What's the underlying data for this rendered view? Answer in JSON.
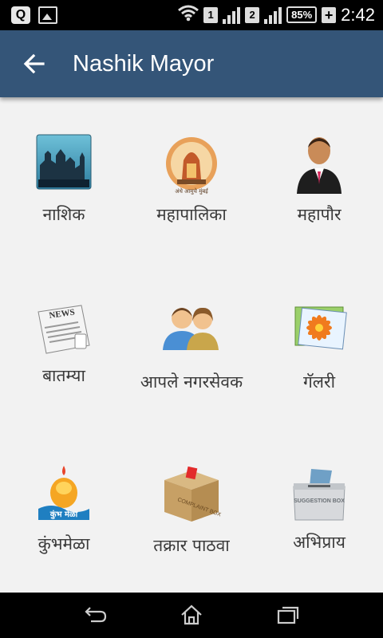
{
  "status_bar": {
    "q_icon_text": "Q",
    "sim1": "1",
    "sim2": "2",
    "battery": "85%",
    "time": "2:42"
  },
  "app_bar": {
    "title": "Nashik Mayor"
  },
  "tiles": [
    {
      "label": "नाशिक",
      "icon": "nashik-city-icon"
    },
    {
      "label": "महापालिका",
      "icon": "corporation-emblem-icon"
    },
    {
      "label": "महापौर",
      "icon": "mayor-person-icon"
    },
    {
      "label": "बातम्या",
      "icon": "newspaper-icon"
    },
    {
      "label": "आपले नगरसेवक",
      "icon": "corporators-people-icon"
    },
    {
      "label": "गॅलरी",
      "icon": "gallery-photos-icon"
    },
    {
      "label": "कुंभमेळा",
      "icon": "kumbh-mela-icon"
    },
    {
      "label": "तक्रार पाठवा",
      "icon": "complaint-box-icon"
    },
    {
      "label": "अभिप्राय",
      "icon": "suggestion-box-icon"
    }
  ],
  "icon_texts": {
    "news": "NEWS",
    "kumbh": "कुंभ मेळा",
    "complaint": "COMPLAINT BOX",
    "suggestion": "SUGGESTION BOX",
    "emblem_caption": "अंधे आमुचे मुंबई"
  },
  "nav": [
    "back-nav-icon",
    "home-nav-icon",
    "recents-nav-icon"
  ]
}
